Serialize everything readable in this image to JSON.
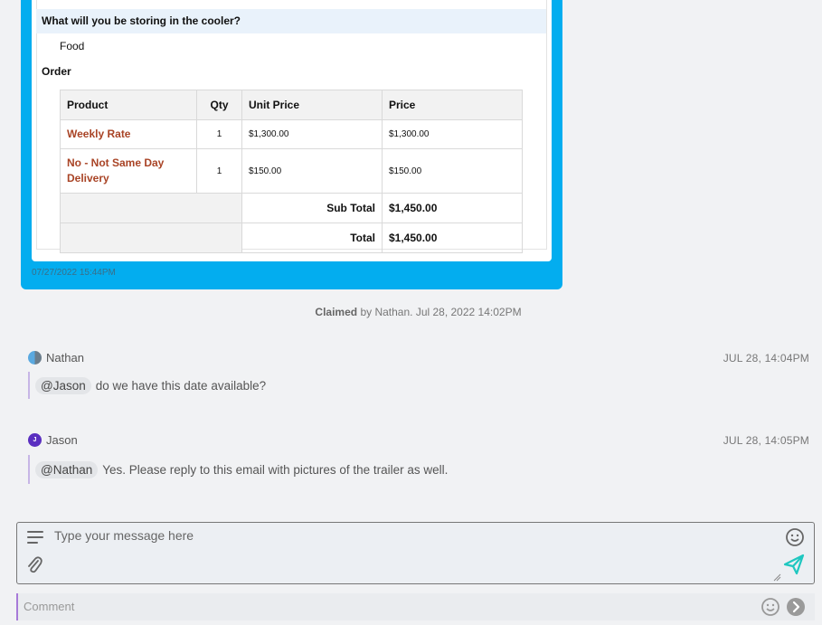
{
  "email": {
    "question": "What will you be storing in the cooler?",
    "answer": "Food",
    "order_label": "Order",
    "columns": [
      "Product",
      "Qty",
      "Unit Price",
      "Price"
    ],
    "rows": [
      {
        "product": "Weekly Rate",
        "qty": "1",
        "unit_price": "$1,300.00",
        "price": "$1,300.00"
      },
      {
        "product": "No - Not Same Day Delivery",
        "qty": "1",
        "unit_price": "$150.00",
        "price": "$150.00"
      }
    ],
    "sub_total_label": "Sub Total",
    "sub_total_value": "$1,450.00",
    "total_label": "Total",
    "total_value": "$1,450.00",
    "timestamp": "07/27/2022 15:44PM",
    "card_color": "#03adef",
    "product_color": "#a94426"
  },
  "claimed": {
    "bold": "Claimed",
    "rest": " by Nathan. Jul 28, 2022 14:02PM"
  },
  "messages": [
    {
      "author": "Nathan",
      "time": "JUL 28, 14:04PM",
      "mention": "@Jason",
      "text": "do we have this date available?",
      "avatar_icon": "avatar-nathan"
    },
    {
      "author": "Jason",
      "initial": "J",
      "time": "JUL 28, 14:05PM",
      "mention": "@Nathan",
      "text": "Yes. Please reply to this email with pictures of the trailer as well.",
      "avatar_icon": "avatar-jason"
    }
  ],
  "composer": {
    "placeholder": "Type your message here",
    "icons": [
      "menu-icon",
      "emoji-icon",
      "attachment-icon",
      "send-icon"
    ],
    "send_color": "#1fc7c0"
  },
  "comment": {
    "placeholder": "Comment",
    "icons": [
      "emoji-icon",
      "submit-arrow-icon"
    ]
  }
}
